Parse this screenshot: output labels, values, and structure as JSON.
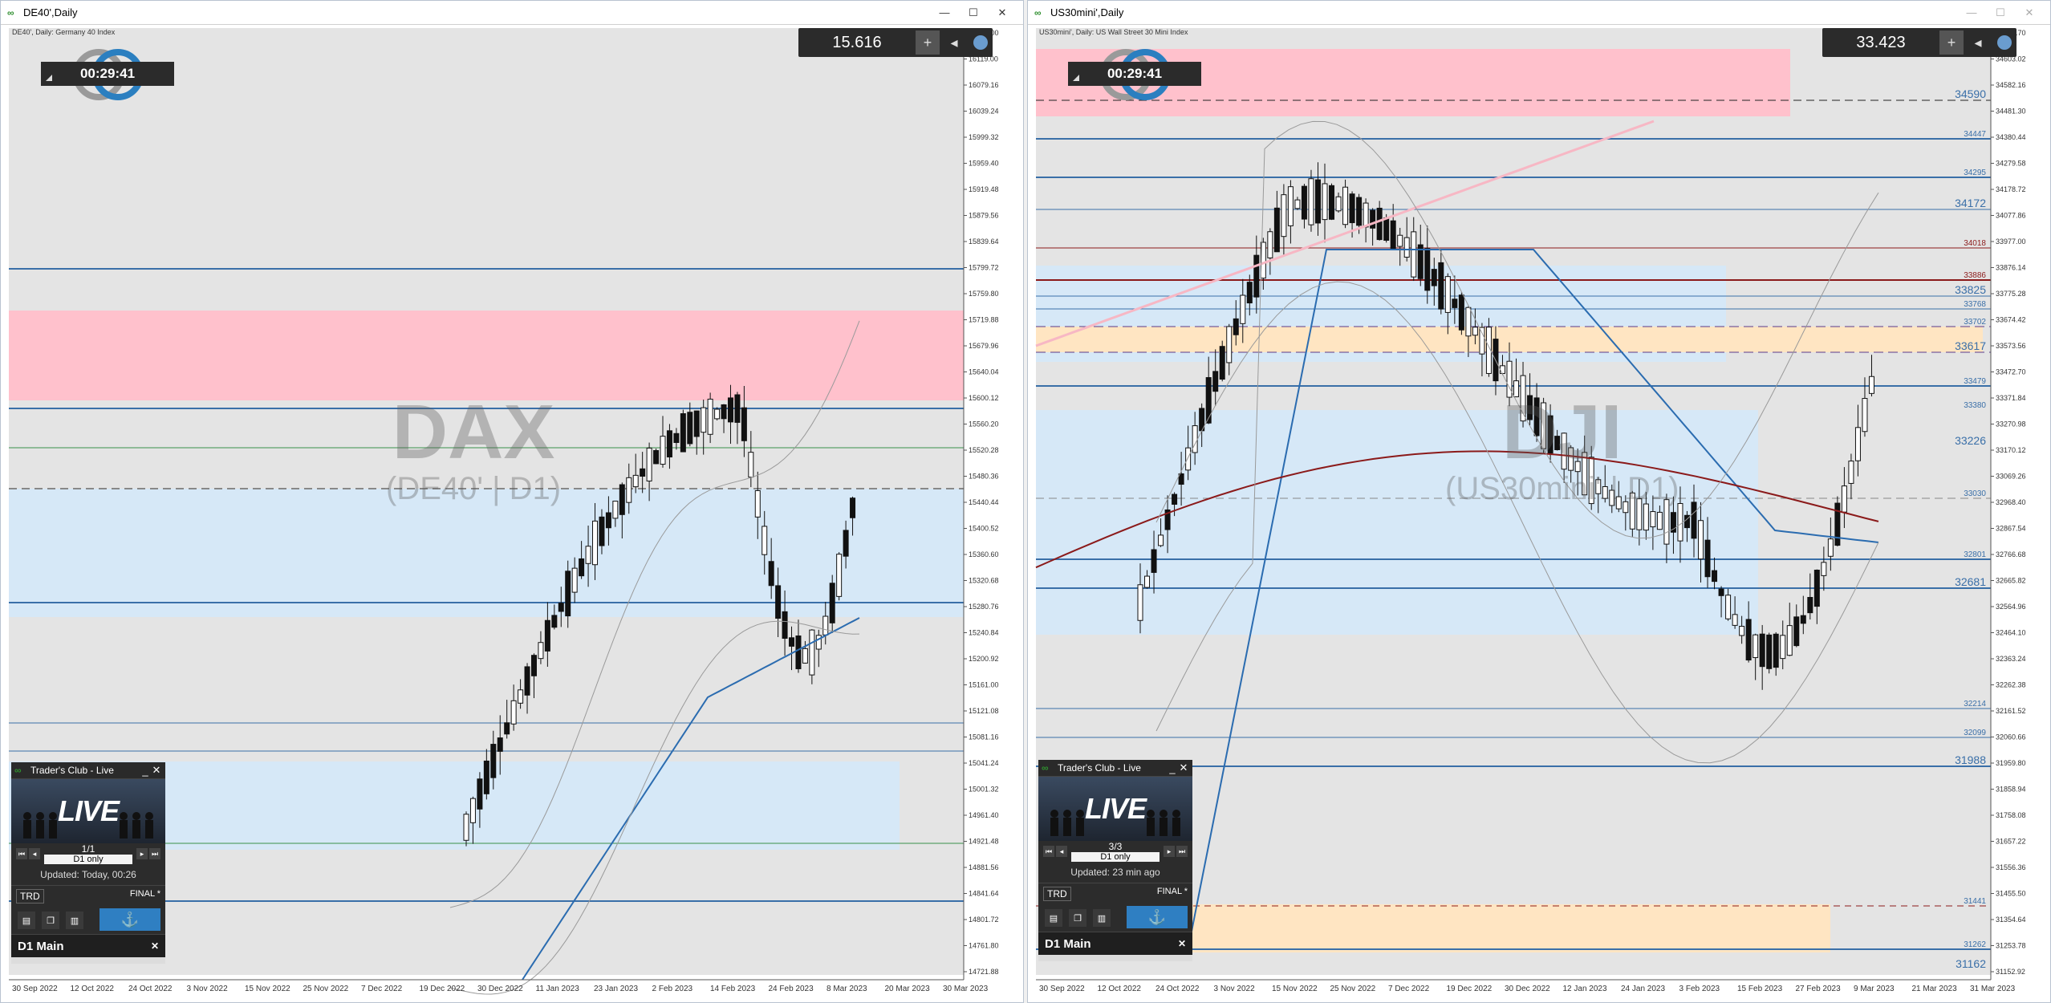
{
  "left": {
    "title": "DE40',Daily",
    "ohlc": "DE40', Daily:  Germany 40 Index",
    "price": "15.616",
    "timer": "00:29:41",
    "watermark_main": "DAX",
    "watermark_sub": "(DE40' | D1)",
    "yticks": [
      "16159.00",
      "16119.00",
      "16079.16",
      "16039.24",
      "15999.32",
      "15959.40",
      "15919.48",
      "15879.56",
      "15839.64",
      "15799.72",
      "15759.80",
      "15719.88",
      "15679.96",
      "15640.04",
      "15600.12",
      "15560.20",
      "15520.28",
      "15480.36",
      "15440.44",
      "15400.52",
      "15360.60",
      "15320.68",
      "15280.76",
      "15240.84",
      "15200.92",
      "15161.00",
      "15121.08",
      "15081.16",
      "15041.24",
      "15001.32",
      "14961.40",
      "14921.48",
      "14881.56",
      "14841.64",
      "14801.72",
      "14761.80",
      "14721.88"
    ],
    "xticks": [
      "30 Sep 2022",
      "12 Oct 2022",
      "24 Oct 2022",
      "3 Nov 2022",
      "15 Nov 2022",
      "25 Nov 2022",
      "7 Dec 2022",
      "19 Dec 2022",
      "30 Dec 2022",
      "11 Jan 2023",
      "23 Jan 2023",
      "2 Feb 2023",
      "14 Feb 2023",
      "24 Feb 2023",
      "8 Mar 2023",
      "20 Mar 2023",
      "30 Mar 2023"
    ]
  },
  "right": {
    "title": "US30mini',Daily",
    "ohlc": "US30mini', Daily:  US Wall Street 30 Mini Index",
    "price": "33.423",
    "timer": "00:29:41",
    "watermark_main": "DJI",
    "watermark_sub": "(US30mini' | D1)",
    "yticks": [
      "34684.70",
      "34603.02",
      "34582.16",
      "34481.30",
      "34380.44",
      "34279.58",
      "34178.72",
      "34077.86",
      "33977.00",
      "33876.14",
      "33775.28",
      "33674.42",
      "33573.56",
      "33472.70",
      "33371.84",
      "33270.98",
      "33170.12",
      "33069.26",
      "32968.40",
      "32867.54",
      "32766.68",
      "32665.82",
      "32564.96",
      "32464.10",
      "32363.24",
      "32262.38",
      "32161.52",
      "32060.66",
      "31959.80",
      "31858.94",
      "31758.08",
      "31657.22",
      "31556.36",
      "31455.50",
      "31354.64",
      "31253.78",
      "31152.92"
    ],
    "xticks": [
      "30 Sep 2022",
      "12 Oct 2022",
      "24 Oct 2022",
      "3 Nov 2022",
      "15 Nov 2022",
      "25 Nov 2022",
      "7 Dec 2022",
      "19 Dec 2022",
      "30 Dec 2022",
      "12 Jan 2023",
      "24 Jan 2023",
      "3 Feb 2023",
      "15 Feb 2023",
      "27 Feb 2023",
      "9 Mar 2023",
      "21 Mar 2023",
      "31 Mar 2023"
    ],
    "levels": [
      "34590",
      "34447",
      "34295",
      "34172",
      "34018",
      "33886",
      "33825",
      "33768",
      "33702",
      "33617",
      "33479",
      "33380",
      "33226",
      "33030",
      "32801",
      "32681",
      "32214",
      "32099",
      "31988",
      "31441",
      "31262",
      "31162"
    ]
  },
  "panels": {
    "left": {
      "title": "Trader's Club - Live",
      "live": "LIVE",
      "page": "1/1",
      "mode": "D1 only",
      "updated": "Updated: Today, 00:26",
      "trd": "TRD",
      "final": "FINAL *",
      "main": "D1 Main"
    },
    "right": {
      "title": "Trader's Club - Live",
      "live": "LIVE",
      "page": "3/3",
      "mode": "D1 only",
      "updated": "Updated: 23 min ago",
      "trd": "TRD",
      "final": "FINAL *",
      "main": "D1 Main"
    }
  },
  "colors": {
    "chart_bg": "#e4e4e4",
    "resistance_zone": "#ffc1cc",
    "support_zone": "#d6e8f7",
    "orange_zone": "#ffe5c2",
    "level_line": "#3a6fa8",
    "ma_red": "#8b1a1a",
    "ma_blue": "#2b6cb0"
  }
}
